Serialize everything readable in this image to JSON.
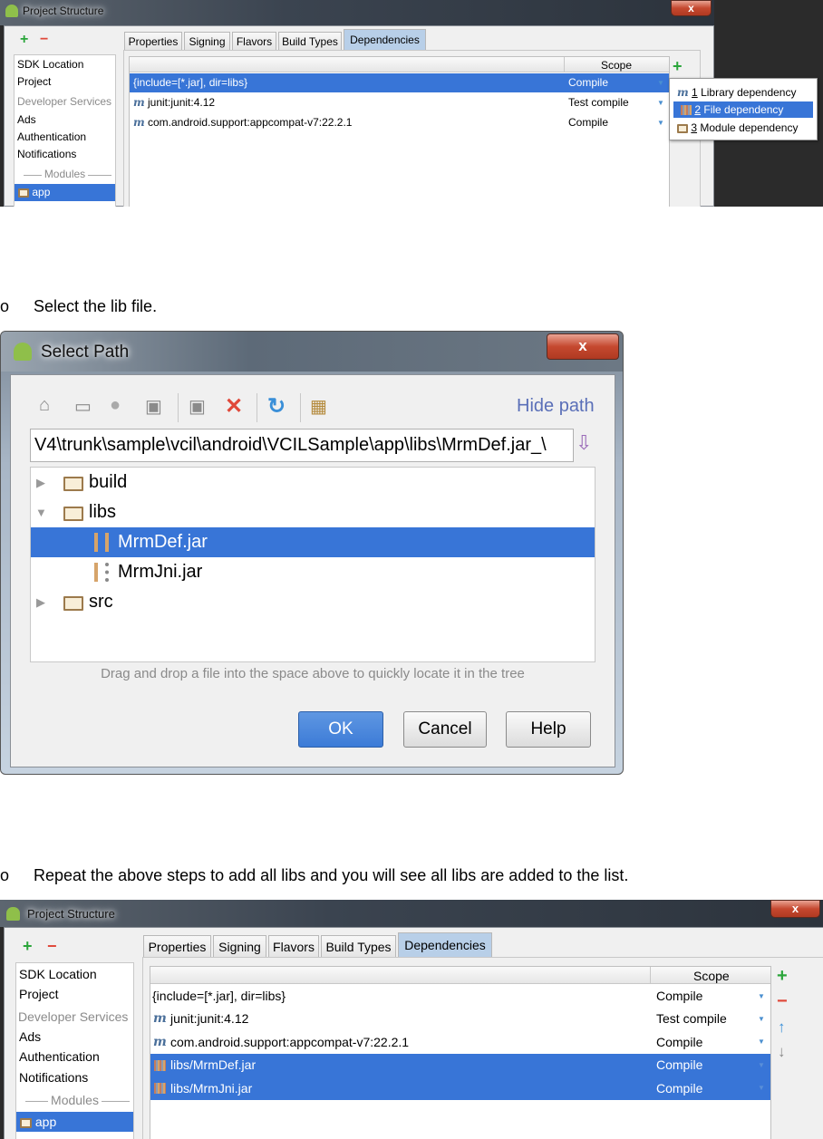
{
  "screenshot1": {
    "window_title": "Project Structure",
    "close_label": "x",
    "sidebar": {
      "items": [
        "SDK Location",
        "Project",
        "Developer Services",
        "Ads",
        "Authentication",
        "Notifications"
      ],
      "modules_label": "Modules",
      "module": "app"
    },
    "tabs": [
      "Properties",
      "Signing",
      "Flavors",
      "Build Types",
      "Dependencies"
    ],
    "active_tab": "Dependencies",
    "table": {
      "scope_header": "Scope",
      "rows": [
        {
          "name": "{include=[*.jar], dir=libs}",
          "scope": "Compile",
          "selected": true
        },
        {
          "name": "junit:junit:4.12",
          "scope": "Test compile",
          "icon": "maven-icon"
        },
        {
          "name": "com.android.support:appcompat-v7:22.2.1",
          "scope": "Compile",
          "icon": "maven-icon"
        }
      ]
    },
    "popup_menu": [
      {
        "num": "1",
        "label": "Library dependency",
        "icon": "maven-icon"
      },
      {
        "num": "2",
        "label": "File dependency",
        "icon": "jar-icon",
        "selected": true
      },
      {
        "num": "3",
        "label": "Module dependency",
        "icon": "module-icon"
      }
    ]
  },
  "step1": "Select the lib file.",
  "step2": "Repeat the above steps to add all libs  and you will see all libs are added to the list.",
  "bullet": "o",
  "select_path": {
    "window_title": "Select Path",
    "close_label": "x",
    "hide_path": "Hide path",
    "path_value": "\\_V4\\trunk\\sample\\vcil\\android\\VCILSample\\app\\libs\\MrmDef.jar",
    "tree": [
      {
        "label": "build",
        "type": "folder",
        "expanded": false
      },
      {
        "label": "libs",
        "type": "folder",
        "expanded": true
      },
      {
        "label": "MrmDef.jar",
        "type": "jar",
        "selected": true
      },
      {
        "label": "MrmJni.jar",
        "type": "jar"
      },
      {
        "label": "src",
        "type": "folder",
        "expanded": false
      }
    ],
    "hint": "Drag and drop a file into the space above to quickly locate it in the tree",
    "buttons": {
      "ok": "OK",
      "cancel": "Cancel",
      "help": "Help"
    },
    "accent": "#3c7bd7"
  },
  "screenshot2": {
    "window_title": "Project Structure",
    "close_label": "x",
    "sidebar": {
      "items": [
        "SDK Location",
        "Project",
        "Developer Services",
        "Ads",
        "Authentication",
        "Notifications"
      ],
      "modules_label": "Modules",
      "module": "app"
    },
    "tabs": [
      "Properties",
      "Signing",
      "Flavors",
      "Build Types",
      "Dependencies"
    ],
    "table": {
      "scope_header": "Scope",
      "rows": [
        {
          "name": "{include=[*.jar], dir=libs}",
          "scope": "Compile"
        },
        {
          "name": "junit:junit:4.12",
          "scope": "Test compile",
          "icon": "maven-icon"
        },
        {
          "name": "com.android.support:appcompat-v7:22.2.1",
          "scope": "Compile",
          "icon": "maven-icon"
        },
        {
          "name": "libs/MrmDef.jar",
          "scope": "Compile",
          "icon": "jar-icon",
          "selected": true
        },
        {
          "name": "libs/MrmJni.jar",
          "scope": "Compile",
          "icon": "jar-icon",
          "selected": true
        }
      ]
    }
  },
  "colors": {
    "selection": "#3875d7",
    "add": "#2aa53a",
    "remove": "#e0483a"
  }
}
